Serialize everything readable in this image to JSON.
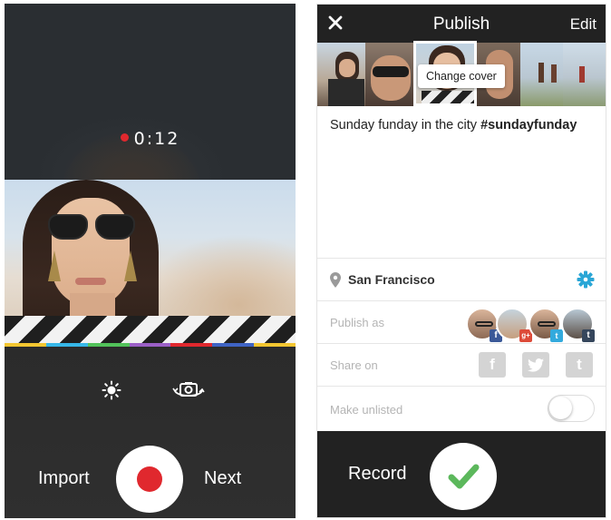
{
  "recorder": {
    "timer": "0:12",
    "import_label": "Import",
    "next_label": "Next",
    "record_color": "#e0282e",
    "progress_colors": [
      "#f4c631",
      "#36b7e8",
      "#52c25a",
      "#9b5fc6",
      "#e0282e",
      "#3f64c4"
    ],
    "icons": [
      "brightness-icon",
      "switch-camera-icon"
    ]
  },
  "publish": {
    "title": "Publish",
    "edit_label": "Edit",
    "change_cover_label": "Change cover",
    "caption_text": "Sunday funday in the city ",
    "caption_hashtag": "#sundayfunday",
    "location": "San Francisco",
    "publish_as_label": "Publish as",
    "share_on_label": "Share on",
    "make_unlisted_label": "Make unlisted",
    "make_unlisted_on": false,
    "publish_as_accounts": [
      "facebook",
      "google-plus",
      "twitter",
      "tumblr"
    ],
    "share_services": [
      "facebook",
      "twitter",
      "tumblr"
    ],
    "record_label": "Record",
    "accent_color": "#2aa6d6",
    "check_color": "#5cb85c"
  }
}
